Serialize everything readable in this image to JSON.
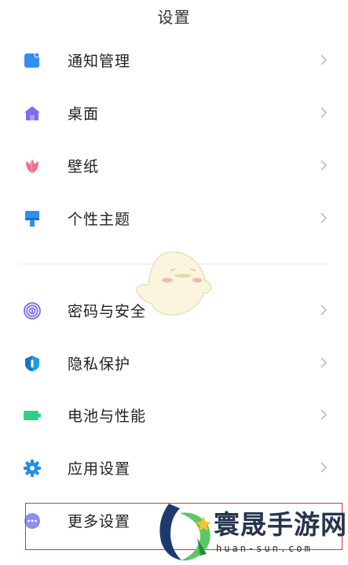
{
  "header": {
    "title": "设置"
  },
  "menu": [
    {
      "label": "通知管理",
      "icon": "notification-icon",
      "color": "#2f8ff0"
    },
    {
      "label": "桌面",
      "icon": "home-icon",
      "color": "#7b6cf0"
    },
    {
      "label": "壁纸",
      "icon": "tulip-icon",
      "color": "#f06e8e"
    },
    {
      "label": "个性主题",
      "icon": "brush-icon",
      "color": "#2f8ff0"
    },
    {
      "label": "密码与安全",
      "icon": "fingerprint-icon",
      "color": "#7b6cf0"
    },
    {
      "label": "隐私保护",
      "icon": "privacy-shield-icon",
      "color": "#1e9be8"
    },
    {
      "label": "电池与性能",
      "icon": "battery-icon",
      "color": "#2fcf85"
    },
    {
      "label": "应用设置",
      "icon": "gear-icon",
      "color": "#1e8fe8"
    },
    {
      "label": "更多设置",
      "icon": "more-icon",
      "color": "#7b7ff0"
    }
  ],
  "watermark": {
    "text": "寰晟手游网",
    "url": "huan-sun.com"
  }
}
